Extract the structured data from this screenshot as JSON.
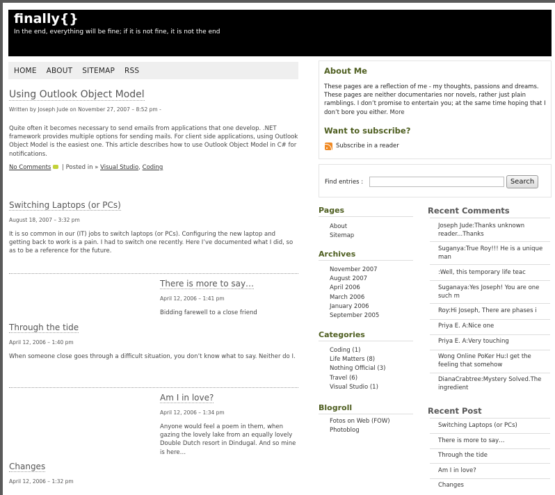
{
  "header": {
    "title": "finally{}",
    "tagline": "In the end, everything will be fine; if it is not fine, it is not the end"
  },
  "nav": [
    "HOME",
    "ABOUT",
    "SITEMAP",
    "RSS"
  ],
  "posts": [
    {
      "title": "Using Outlook Object Model",
      "meta": "Written by Joseph Jude on November 27, 2007 – 8:52 pm -",
      "excerpt": "Quite often it becomes necessary to send emails from applications that one develop. .NET framework provides multiple options for sending mails. For client side applications, using Outlook Object Model is the easiest one. This article describes how to use Outlook Object Model in C# for notifications.",
      "comments": "No Comments",
      "posted_in_prefix": " | Posted in » ",
      "cat1": "Visual Studio",
      "cat2": "Coding"
    },
    {
      "title": "Switching Laptops (or PCs)",
      "meta": "August 18, 2007 – 3:32 pm",
      "excerpt": "It is so common in our (IT) jobs to switch laptops (or PCs). Configuring the new laptop and getting back to work is a pain. I had to switch one recently. Here I’ve documented what I did, so as to be a reference for the future."
    },
    {
      "title": "There is more to say…",
      "meta": "April 12, 2006 – 1:41 pm",
      "excerpt": "Bidding farewell to a close friend"
    },
    {
      "title": "Through the tide",
      "meta": "April 12, 2006 – 1:40 pm",
      "excerpt": "When someone close goes through a difficult situation, you don’t know what to say. Neither do I."
    },
    {
      "title": "Am I in love?",
      "meta": "April 12, 2006 – 1:34 pm",
      "excerpt": "Anyone would feel a poem in them, when gazing the lovely lake from an equally lovely Double Dutch resort in Dindugal. And so mine is here…"
    },
    {
      "title": "Changes",
      "meta": "April 12, 2006 – 1:32 pm"
    }
  ],
  "about": {
    "heading": "About Me",
    "text": "These pages are a reflection of me - my thoughts, passions and dreams. These pages are neither documentaries nor novels, rather just plain ramblings. I don’t promise to entertain you; at the same time hoping that I don’t bore you either.",
    "more": "More"
  },
  "subscribe": {
    "heading": "Want to subscribe?",
    "link": "Subscribe in a reader"
  },
  "search": {
    "label": "Find entries :",
    "placeholder": "",
    "button": "Search"
  },
  "pages": {
    "heading": "Pages",
    "items": [
      "About",
      "Sitemap"
    ]
  },
  "archives": {
    "heading": "Archives",
    "items": [
      "November 2007",
      "August 2007",
      "April 2006",
      "March 2006",
      "January 2006",
      "September 2005"
    ]
  },
  "categories": {
    "heading": "Categories",
    "items": [
      "Coding (1)",
      "Life Matters (8)",
      "Nothing Official (3)",
      "Travel (6)",
      "Visual Studio (1)"
    ]
  },
  "blogroll": {
    "heading": "Blogroll",
    "items": [
      "Fotos on Web (FOW)",
      "Photoblog"
    ]
  },
  "recent_comments": {
    "heading": "Recent Comments",
    "items": [
      "Joseph Jude:Thanks unknown reader...Thanks",
      "Suganya:True Roy!!! He is a unique man",
      ":Well, this temporary life teac",
      "Suganaya:Yes Joseph! You are one such m",
      "Roy:Hi Joseph, There are phases i",
      "Priya E. A:Nice one",
      "Priya E. A:Very touching",
      "Wong Online PoKer Hu:I get the feeling that somehow",
      "DianaCrabtree:Mystery Solved.The ingredient"
    ]
  },
  "recent_posts": {
    "heading": "Recent Post",
    "items": [
      "Switching Laptops (or PCs)",
      "There is more to say…",
      "Through the tide",
      "Am I in love?",
      "Changes"
    ]
  },
  "colors": {
    "header_bg": "#000000",
    "sidebar_heading": "#4e5e20",
    "nav_bg": "#efefef"
  }
}
